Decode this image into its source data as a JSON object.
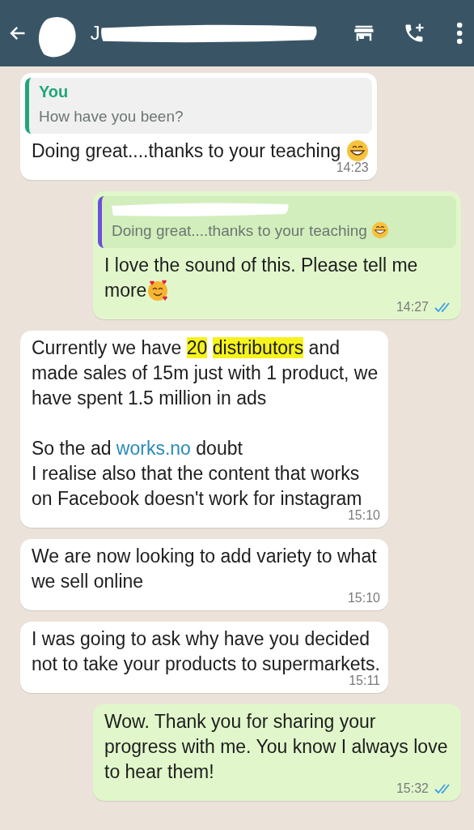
{
  "header": {
    "title": "J",
    "redacted": true
  },
  "messages": [
    {
      "kind": "incoming",
      "quote": {
        "author": "You",
        "color": "#1fa67a",
        "text": [
          {
            "kind": "text",
            "text": "How have you been?"
          }
        ]
      },
      "text": [
        {
          "kind": "text",
          "text": "Doing great....thanks to your teaching "
        },
        {
          "kind": "grin"
        }
      ],
      "time": "14:23"
    },
    {
      "kind": "outgoing",
      "quote": {
        "author_redacted": true,
        "color": "#6b4fd8",
        "text": [
          {
            "kind": "text",
            "text": "Doing great....thanks to your teaching "
          },
          {
            "kind": "grin"
          }
        ]
      },
      "text": [
        {
          "kind": "text",
          "text": "I love the sound of this. Please tell me more"
        },
        {
          "kind": "hearts"
        }
      ],
      "time": "14:27",
      "read": true
    },
    {
      "kind": "incoming",
      "text": [
        {
          "kind": "text",
          "text": "Currently we have "
        },
        {
          "kind": "highlight",
          "text": "20 distributors"
        },
        {
          "kind": "text",
          "text": " and made sales of 15m just with 1 product, we have spent 1.5 million in ads\n\nSo the ad "
        },
        {
          "kind": "link",
          "text": "works.no"
        },
        {
          "kind": "text",
          "text": " doubt\nI realise also that the content that works on Facebook doesn't work for instagram"
        }
      ],
      "time": "15:10"
    },
    {
      "kind": "incoming",
      "text": [
        {
          "kind": "text",
          "text": "We are now looking to add variety to what we sell online"
        }
      ],
      "time": "15:10"
    },
    {
      "kind": "incoming",
      "text": [
        {
          "kind": "text",
          "text": "I was going to ask why have you decided not to take your products to supermarkets."
        }
      ],
      "time": "15:11"
    },
    {
      "kind": "outgoing",
      "text": [
        {
          "kind": "text",
          "text": "Wow. Thank you for sharing your progress with me. You know I always love to hear them!"
        }
      ],
      "time": "15:32",
      "read": true
    }
  ]
}
